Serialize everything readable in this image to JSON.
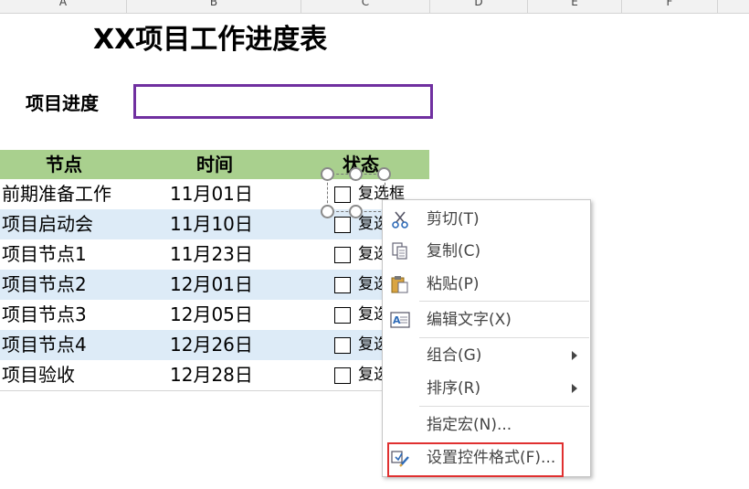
{
  "column_headers": [
    "A",
    "B",
    "C",
    "D",
    "E",
    "F"
  ],
  "title": "XX项目工作进度表",
  "progress": {
    "label": "项目进度",
    "value": ""
  },
  "table": {
    "headers": [
      "节点",
      "时间",
      "状态"
    ],
    "rows": [
      {
        "node": "前期准备工作",
        "date": "11月01日",
        "status": "复选框"
      },
      {
        "node": "项目启动会",
        "date": "11月10日",
        "status": "复选框"
      },
      {
        "node": "项目节点1",
        "date": "11月23日",
        "status": "复选框"
      },
      {
        "node": "项目节点2",
        "date": "12月01日",
        "status": "复选框"
      },
      {
        "node": "项目节点3",
        "date": "12月05日",
        "status": "复选框"
      },
      {
        "node": "项目节点4",
        "date": "12月26日",
        "status": "复选框"
      },
      {
        "node": "项目验收",
        "date": "12月28日",
        "status": "复选框"
      }
    ]
  },
  "context_menu": {
    "items": [
      {
        "label": "剪切(T)",
        "icon": "scissors-icon"
      },
      {
        "label": "复制(C)",
        "icon": "copy-icon"
      },
      {
        "label": "粘贴(P)",
        "icon": "paste-icon"
      },
      {
        "label": "编辑文字(X)",
        "icon": "edit-text-icon"
      },
      {
        "label": "组合(G)",
        "icon": ""
      },
      {
        "label": "排序(R)",
        "icon": ""
      },
      {
        "label": "指定宏(N)...",
        "icon": ""
      },
      {
        "label": "设置控件格式(F)...",
        "icon": "format-control-icon"
      }
    ]
  },
  "colors": {
    "header_green": "#a9d08e",
    "row_blue": "#ddebf7",
    "progress_border": "#7030a0",
    "highlight_red": "#e03030"
  }
}
